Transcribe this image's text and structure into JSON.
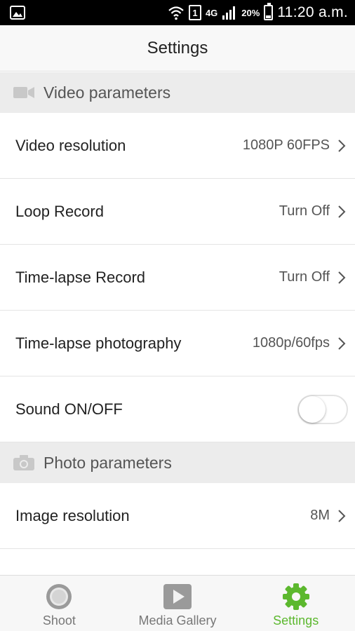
{
  "statusbar": {
    "network": "4G",
    "sim": "1",
    "battery": "20%",
    "time": "11:20 a.m."
  },
  "header": {
    "title": "Settings"
  },
  "sections": [
    {
      "label": "Video parameters",
      "icon": "video-camera-icon"
    },
    {
      "label": "Photo parameters",
      "icon": "photo-camera-icon"
    }
  ],
  "video_rows": [
    {
      "label": "Video resolution",
      "value": "1080P 60FPS"
    },
    {
      "label": "Loop Record",
      "value": "Turn Off"
    },
    {
      "label": "Time-lapse Record",
      "value": "Turn Off"
    },
    {
      "label": "Time-lapse photography",
      "value": "1080p/60fps"
    },
    {
      "label": "Sound ON/OFF",
      "toggle": false
    }
  ],
  "photo_rows": [
    {
      "label": "Image resolution",
      "value": "8M"
    }
  ],
  "nav": [
    {
      "label": "Shoot",
      "icon": "shoot-circle-icon",
      "active": false
    },
    {
      "label": "Media Gallery",
      "icon": "play-icon",
      "active": false
    },
    {
      "label": "Settings",
      "icon": "gear-icon",
      "active": true
    }
  ],
  "colors": {
    "accent": "#5cb82e",
    "section_bg": "#ececec"
  }
}
